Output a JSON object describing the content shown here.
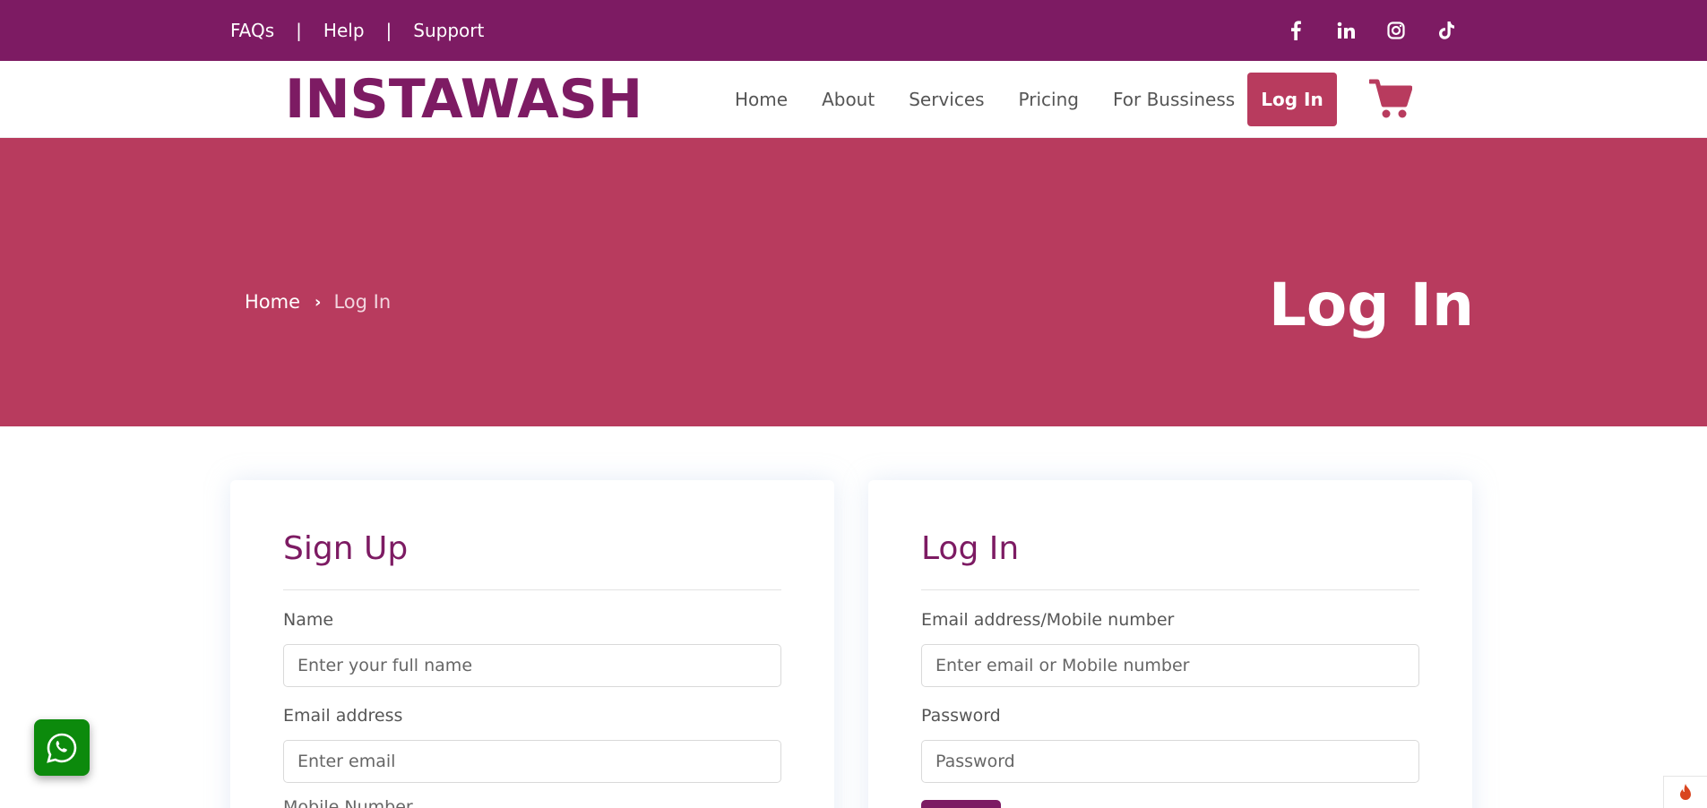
{
  "topbar": {
    "links": [
      "FAQs",
      "Help",
      "Support"
    ],
    "separator": "|",
    "social_icons": [
      "facebook-icon",
      "linkedin-icon",
      "instagram-icon",
      "tiktok-icon"
    ]
  },
  "navbar": {
    "logo": "INSTAWASH",
    "menu": [
      "Home",
      "About",
      "Services",
      "Pricing",
      "For Bussiness"
    ],
    "login_label": "Log In",
    "cart_icon": "cart-icon"
  },
  "hero": {
    "breadcrumb_home": "Home",
    "breadcrumb_current": "Log In",
    "title": "Log In"
  },
  "signup": {
    "title": "Sign Up",
    "name_label": "Name",
    "name_placeholder": "Enter your full name",
    "email_label": "Email address",
    "email_placeholder": "Enter email",
    "mobile_label": "Mobile Number"
  },
  "login": {
    "title": "Log In",
    "id_label": "Email address/Mobile number",
    "id_placeholder": "Enter email or Mobile number",
    "password_label": "Password",
    "password_placeholder": "Password"
  },
  "colors": {
    "brand_purple": "#7d1b63",
    "brand_pink": "#b83b5e",
    "whatsapp_green": "#0c8a0c"
  }
}
